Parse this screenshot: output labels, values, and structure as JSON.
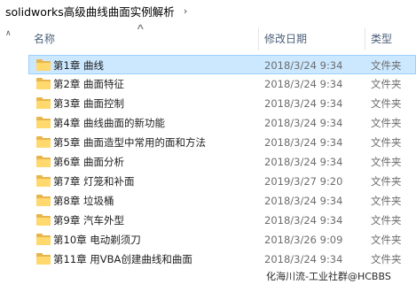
{
  "breadcrumb": {
    "folder": "solidworks高级曲线曲面实例解析"
  },
  "columns": {
    "name": "名称",
    "date": "修改日期",
    "type": "类型"
  },
  "files": [
    {
      "name": "第1章 曲线",
      "date": "2018/3/24 9:34",
      "type": "文件夹",
      "selected": true
    },
    {
      "name": "第2章 曲面特征",
      "date": "2018/3/24 9:34",
      "type": "文件夹"
    },
    {
      "name": "第3章 曲面控制",
      "date": "2018/3/24 9:34",
      "type": "文件夹"
    },
    {
      "name": "第4章 曲线曲面的新功能",
      "date": "2018/3/24 9:34",
      "type": "文件夹"
    },
    {
      "name": "第5章 曲面造型中常用的面和方法",
      "date": "2018/3/24 9:34",
      "type": "文件夹"
    },
    {
      "name": "第6章 曲面分析",
      "date": "2018/3/24 9:34",
      "type": "文件夹"
    },
    {
      "name": "第7章 灯笼和补面",
      "date": "2019/3/27 9:20",
      "type": "文件夹"
    },
    {
      "name": "第8章 垃圾桶",
      "date": "2018/3/24 9:34",
      "type": "文件夹"
    },
    {
      "name": "第9章 汽车外型",
      "date": "2018/3/24 9:34",
      "type": "文件夹"
    },
    {
      "name": "第10章 电动剃须刀",
      "date": "2018/3/26 9:09",
      "type": "文件夹"
    },
    {
      "name": "第11章 用VBA创建曲线和曲面",
      "date": "2018/3/24 9:34",
      "type": "文件夹"
    }
  ],
  "watermark": "化海川流-工业社群@HCBBS",
  "colors": {
    "selected_bg": "#cce8ff",
    "selected_border": "#99d1ff",
    "header_text": "#4c607a",
    "folder_yellow": "#ffd86e"
  }
}
